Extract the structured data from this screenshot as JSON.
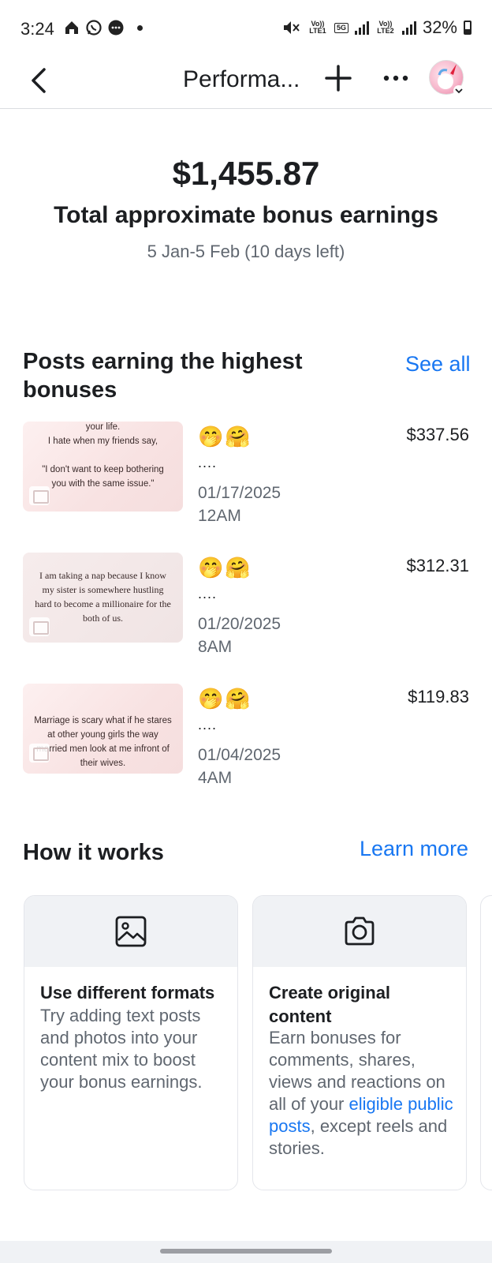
{
  "status_bar": {
    "time": "3:24",
    "net1": "Vo)) LTE1",
    "net_5g": "5G",
    "net2": "Vo)) LTE2",
    "battery": "32%"
  },
  "header": {
    "title": "Performa...",
    "back_icon": "chevron-left-icon",
    "plus_icon": "plus-icon",
    "more_icon": "more-horizontal-icon"
  },
  "summary": {
    "amount": "$1,455.87",
    "label": "Total approximate bonus earnings",
    "date_range": "5 Jan-5 Feb (10 days left)"
  },
  "top_posts": {
    "title": "Posts earning the highest bonuses",
    "see_all": "See all",
    "posts": [
      {
        "thumb_text": "your life.\nI hate when my friends say,\n\n\"I don't want to keep bothering you with the same issue.\"",
        "emojis": "🤭🤗",
        "dots": "....",
        "date": "01/17/2025",
        "time": "12AM",
        "amount": "$337.56"
      },
      {
        "thumb_text": "I am taking a nap because I know my sister is somewhere hustling hard to become a millionaire for the both of us.",
        "emojis": "🤭🤗",
        "dots": "....",
        "date": "01/20/2025",
        "time": "8AM",
        "amount": "$312.31"
      },
      {
        "thumb_text": "Marriage is scary what if he stares at other young girls the way married men look at me infront of their wives.",
        "emojis": "🤭🤗",
        "dots": "....",
        "date": "01/04/2025",
        "time": "4AM",
        "amount": "$119.83"
      }
    ]
  },
  "how_it_works": {
    "title": "How it works",
    "learn_more": "Learn more",
    "cards": [
      {
        "icon": "image-icon",
        "title": "Use different formats",
        "body": "Try adding text posts and photos into your content mix to boost your bonus earnings."
      },
      {
        "icon": "camera-icon",
        "title": "Create original content",
        "body_pre": "Earn bonuses for comments, shares, views and reactions on all of your ",
        "body_link": "eligible public posts",
        "body_post": ", except reels and stories."
      }
    ]
  }
}
